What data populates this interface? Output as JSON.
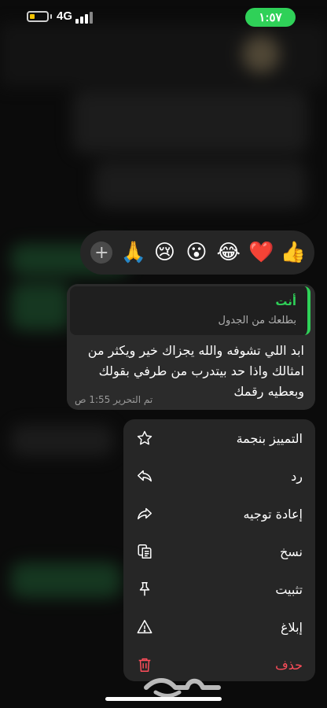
{
  "status_bar": {
    "network": "4G",
    "time": "١:٥٧"
  },
  "reactions": {
    "items": [
      "👍",
      "❤️",
      "😂",
      "😮",
      "😢",
      "🙏"
    ],
    "add_label": "+"
  },
  "message": {
    "quote": {
      "sender": "أنت",
      "text": "بطلعك من الجدول"
    },
    "text": "ابد اللي تشوفه والله يجزاك خير ويكثر من امثالك واذا حد بيتدرب من طرفي بقولك وبعطيه رقمك",
    "meta": "تم التحرير 1:55 ص"
  },
  "menu": {
    "items": [
      {
        "label": "التمييز بنجمة",
        "icon": "star-icon"
      },
      {
        "label": "رد",
        "icon": "reply-icon"
      },
      {
        "label": "إعادة توجيه",
        "icon": "forward-icon"
      },
      {
        "label": "نسخ",
        "icon": "copy-icon"
      },
      {
        "label": "تثبيت",
        "icon": "pin-icon"
      },
      {
        "label": "إبلاغ",
        "icon": "report-icon"
      },
      {
        "label": "حذف",
        "icon": "trash-icon",
        "color": "#ff4d5a"
      }
    ]
  },
  "colors": {
    "accent": "#2fd158",
    "danger": "#ff4d5a"
  },
  "watermark": {
    "text": "حراج"
  }
}
